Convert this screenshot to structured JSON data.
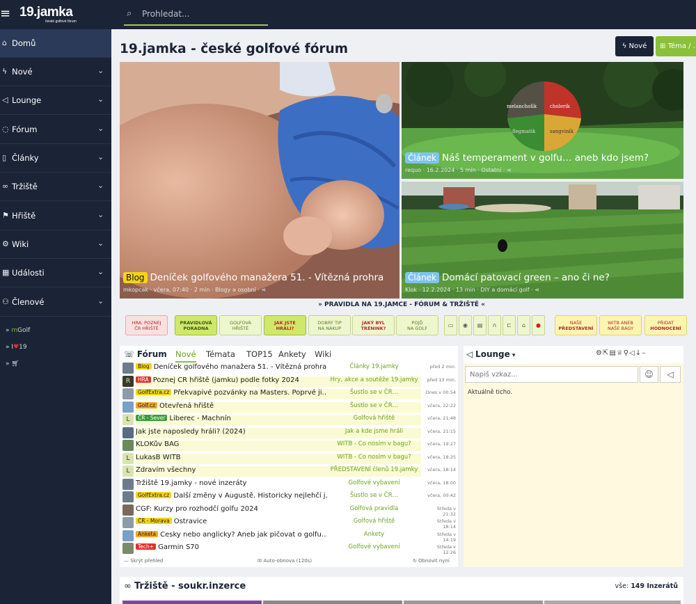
{
  "header": {
    "logo_text": "19.jamka",
    "logo_sub": "české golfové fórum",
    "search_placeholder": "Prohledat..."
  },
  "sidebar": {
    "items": [
      {
        "label": "Domů",
        "icon": "home-icon"
      },
      {
        "label": "Nové",
        "icon": "bolt-icon"
      },
      {
        "label": "Lounge",
        "icon": "megaphone-icon"
      },
      {
        "label": "Fórum",
        "icon": "chat-icon"
      },
      {
        "label": "Články",
        "icon": "document-icon"
      },
      {
        "label": "Tržiště",
        "icon": "handshake-icon"
      },
      {
        "label": "Hřiště",
        "icon": "golf-flag-icon"
      },
      {
        "label": "Wiki",
        "icon": "gear-icon"
      },
      {
        "label": "Události",
        "icon": "calendar-icon"
      },
      {
        "label": "Členové",
        "icon": "users-icon"
      }
    ],
    "links": [
      {
        "prefix": "m",
        "label": "Golf"
      },
      {
        "prefix": "I",
        "label": "19"
      },
      {
        "label": ""
      }
    ]
  },
  "page": {
    "title": "19.jamka - české golfové fórum",
    "btn_nove": "Nové",
    "btn_tema": "Téma / ..."
  },
  "heroes": [
    {
      "tag": "Blog",
      "title": "Deníček golfového manažera 51. - Vítězná prohra",
      "meta": "mkopcak · včera, 07:40 · 2 min · Blogy a osobní ·"
    },
    {
      "tag": "Článek",
      "title": "Náš temperament v golfu… aneb kdo jsem?",
      "meta": "requo · 16.2.2024 · 5 min · Ostatní ·",
      "pie_labels": [
        "melancholik",
        "cholerik",
        "flegmatik",
        "sangvinik"
      ]
    },
    {
      "tag": "Článek",
      "title": "Domácí patovací green – ano či ne?",
      "meta": "Klok · 12.2.2024 · 13 min · DIY a domácí golf ·"
    }
  ],
  "rules_title": "» PRAVIDLA NA 19.JAMCE - FÓRUM & TRŽIŠTĚ «",
  "quick_buttons": [
    {
      "l1": "HRA: POZNEJ",
      "l2": "ČR HŘIŠTĚ"
    },
    {
      "l1": "PRAVIDLOVÁ",
      "l2": "PORADNA"
    },
    {
      "l1": "GOLFOVÁ",
      "l2": "HŘIŠTĚ"
    },
    {
      "l1": "JAK JSTE",
      "l2": "HRÁLI?"
    },
    {
      "l1": "DOBRÝ TIP",
      "l2": "NA NÁKUP"
    },
    {
      "l1": "JAKÝ BYL",
      "l2": "TRÉNINK?"
    },
    {
      "l1": "POJĎ",
      "l2": "NA GOLF"
    },
    {
      "l1": "NAŠE",
      "l2": "PŘEDSTAVENÍ"
    },
    {
      "l1": "WITB ANEB",
      "l2": "NAŠE BAGY"
    },
    {
      "l1": "PŘIDAT",
      "l2": "HODNOCENÍ"
    }
  ],
  "forum": {
    "title": "Fórum",
    "tabs": [
      "Nové",
      "Témata",
      "TOP15",
      "Ankety",
      "Wiki"
    ],
    "rows": [
      {
        "tag": "Blog",
        "title": "Deníček golfového manažera 51. - Vítězná prohra",
        "cat": "Články 19.jamky",
        "time": "před 2 min."
      },
      {
        "tag": "HRA",
        "title": "Poznej ČR hřiště (jamku) podle fotky 2024",
        "cat": "Hry, akce a soutěže 19.jamky",
        "time": "před 13 min."
      },
      {
        "tag": "GolfExtra.cz",
        "title": "Překvapivé pozvánky na Masters. Poprvé ji…",
        "cat": "Šustlo se v ČR…",
        "time": "Dnes v 00:54"
      },
      {
        "tag": "Golf.cz",
        "title": "Otevřená hřiště",
        "cat": "Šustlo se v ČR…",
        "time": "včera, 22:22"
      },
      {
        "tag": "ČR - Sever",
        "title": "Liberec - Machnín",
        "cat": "Golfová hřiště",
        "time": "včera, 21:48"
      },
      {
        "tag": "",
        "title": "Jak jste naposledy hráli? (2024)",
        "cat": "Jak a kde jsme hráli",
        "time": "včera, 21:15"
      },
      {
        "tag": "",
        "title": "KLOKův BAG",
        "cat": "WITB - Co nosím v bagu?",
        "time": "včera, 19:27"
      },
      {
        "tag": "",
        "title": "LukasB WITB",
        "cat": "WITB - Co nosím v bagu?",
        "time": "včera, 18:25"
      },
      {
        "tag": "",
        "title": "Zdravím všechny",
        "cat": "PŘEDSTAVENÍ členů 19.jamky",
        "time": "včera, 18:14"
      },
      {
        "tag": "",
        "title": "Tržiště 19.jamky - nové inzeráty",
        "cat": "Golfové vybavení",
        "time": "včera, 18:00"
      },
      {
        "tag": "GolfExtra.cz",
        "title": "Další změny v Augustě. Historicky nejlehčí j…",
        "cat": "Šustlo se v ČR…",
        "time": "včera, 00:42"
      },
      {
        "tag": "",
        "title": "ČGF: Kurzy pro rozhodčí golfu 2024",
        "cat": "Golfová pravidla",
        "time": "Středa v 21:32"
      },
      {
        "tag": "ČR - Morava",
        "title": "Ostravice",
        "cat": "Golfová hřiště",
        "time": "Středa v 18:14"
      },
      {
        "tag": "Anketa",
        "title": "Česky nebo anglicky? Aneb jak pičovat o golfu…",
        "cat": "Ankety",
        "time": "Středa v 14:19"
      },
      {
        "tag": "Tech+",
        "title": "Garmin S70",
        "cat": "Golfové vybavení",
        "time": "Středa v 12:26"
      }
    ],
    "footer_left": "— Skrýt přehled",
    "footer_mid": "Auto-obnova (120s)",
    "footer_right": "Obnovit nyní"
  },
  "lounge": {
    "title": "Lounge",
    "input_placeholder": "Napiš vzkaz...",
    "status": "Aktuálně ticho."
  },
  "market": {
    "title": "Tržiště - soukr.inzerce",
    "count_label": "vše:",
    "count": "149 Inzerátů"
  },
  "colors": {
    "navy": "#1b2436",
    "green": "#8ac03a",
    "yellow_tag": "#f5d415",
    "light_blue_tag": "#7dc3f0"
  }
}
